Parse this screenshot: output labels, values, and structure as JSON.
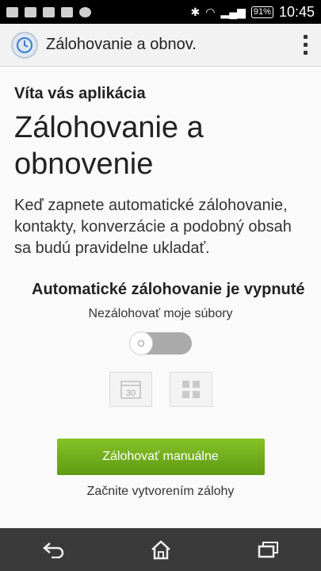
{
  "status_bar": {
    "battery": "91%",
    "time": "10:45"
  },
  "action_bar": {
    "title": "Zálohovanie a obnov."
  },
  "content": {
    "welcome": "Víta vás aplikácia",
    "headline": "Zálohovanie a obnovenie",
    "description": "Keď zapnete automatické zálohovanie, kontakty, konverzácie a podobný obsah sa budú pravidelne ukladať.",
    "auto_backup_status": "Automatické zálohovanie je vypnuté",
    "auto_backup_sub": "Nezálohovať moje súbory",
    "toggle_on": false,
    "calendar_icon_text": "30",
    "manual_backup_button": "Zálohovať manuálne",
    "hint": "Začnite vytvorením zálohy"
  },
  "colors": {
    "accent_green": "#6ea81b",
    "status_bar": "#000000",
    "nav_bar": "#3a3a3a"
  },
  "icons": [
    "back-icon",
    "home-icon",
    "recents-icon",
    "overflow-menu-icon",
    "app-backup-icon",
    "calendar-icon",
    "apps-grid-icon"
  ]
}
